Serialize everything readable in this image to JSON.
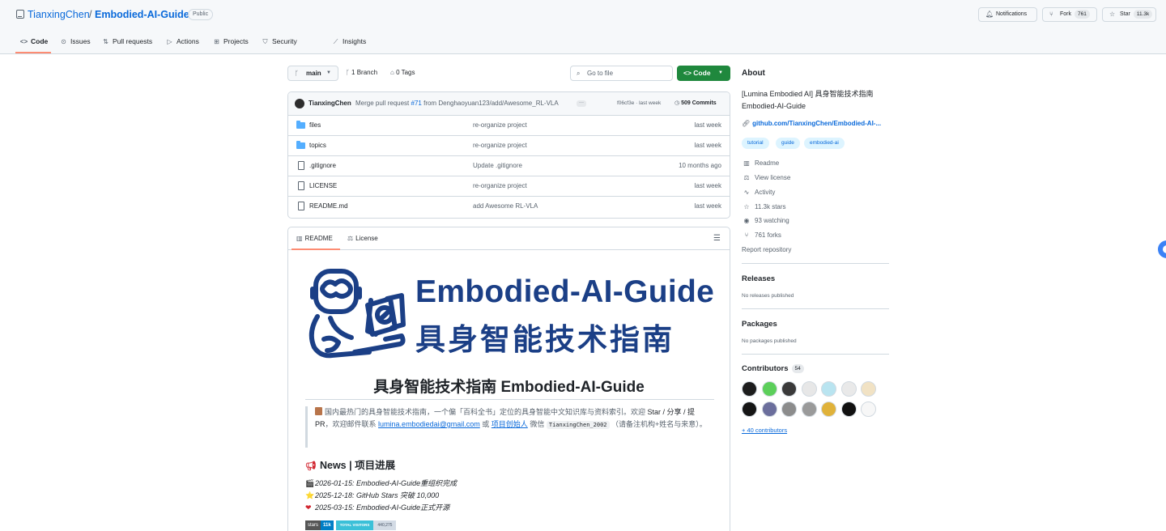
{
  "repo": {
    "owner": "TianxingChen",
    "slash": "/",
    "name": "Embodied-AI-Guide",
    "visibility": "Public"
  },
  "header_buttons": {
    "notifications": "Notifications",
    "fork": "Fork",
    "fork_count": "761",
    "star": "Star",
    "star_count": "11.3k"
  },
  "tabs": [
    {
      "label": "Code",
      "icon": "code-icon"
    },
    {
      "label": "Issues",
      "icon": "issue-icon"
    },
    {
      "label": "Pull requests",
      "icon": "pull-request-icon"
    },
    {
      "label": "Actions",
      "icon": "play-icon"
    },
    {
      "label": "Projects",
      "icon": "table-icon"
    },
    {
      "label": "Security",
      "icon": "shield-icon"
    },
    {
      "label": "Insights",
      "icon": "graph-icon"
    }
  ],
  "toolbar": {
    "branch": "main",
    "branch_count": "1 Branch",
    "tag_count": "0 Tags",
    "goto_placeholder": "Go to file",
    "code_button": "Code"
  },
  "commit": {
    "author": "TianxingChen",
    "msg_prefix": "Merge pull request",
    "pr": "#71",
    "msg_suffix": "from Denghaoyuan123/add/Awesome_RL-VLA",
    "hash_date": "f06cf3e · last week",
    "count": "509 Commits"
  },
  "files": [
    {
      "name": "files",
      "type": "folder",
      "message": "re-organize project",
      "date": "last week"
    },
    {
      "name": "topics",
      "type": "folder",
      "message": "re-organize project",
      "date": "last week"
    },
    {
      "name": ".gitignore",
      "type": "file",
      "message": "Update .gitignore",
      "date": "10 months ago"
    },
    {
      "name": "LICENSE",
      "type": "file",
      "message": "re-organize project",
      "date": "last week"
    },
    {
      "name": "README.md",
      "type": "file",
      "message": "add Awesome RL-VLA",
      "date": "last week"
    }
  ],
  "readme": {
    "tab_readme": "README",
    "tab_license": "License",
    "logo_en": "Embodied-AI-Guide",
    "logo_zh": "具身智能技术指南",
    "h1": "具身智能技术指南 Embodied-AI-Guide",
    "quote": {
      "t1": "国内最热门的具身智能技术指南，一个偏「百科全书」定位的具身智能中文知识库与资料索引。欢迎",
      "s1": "Star / 分享 / 提 PR",
      "t2": "，欢迎邮件联系",
      "email": "lumina.embodiedai@gmail.com",
      "t3": "或",
      "founder": "项目创始人",
      "t4": "微信",
      "wechat": "TianxingChen_2002",
      "t5": "（请备注机构+姓名与来意）。"
    },
    "news_title": "News | 项目进展",
    "news": [
      {
        "emoji": "🎬",
        "text": "2026-01-15: Embodied-AI-Guide重组织完成"
      },
      {
        "emoji": "⭐",
        "text": "2025-12-18: GitHub Stars 突破 10,000"
      },
      {
        "emoji": "❤",
        "text": "2025-03-15: Embodied-AI-Guide正式开源"
      }
    ],
    "badges": {
      "stars_label": "stars",
      "stars_value": "11k",
      "visitors_label": "TOTAL VISITORS",
      "visitors_value": "440,275"
    }
  },
  "about": {
    "title": "About",
    "description": "[Lumina Embodied AI] 具身智能技术指南 Embodied-AI-Guide",
    "link": "github.com/TianxingChen/Embodied-AI-...",
    "topics": [
      "tutorial",
      "guide",
      "embodied-ai"
    ],
    "meta": [
      {
        "icon": "book-icon",
        "label": "Readme"
      },
      {
        "icon": "law-icon",
        "label": "View license"
      },
      {
        "icon": "pulse-icon",
        "label": "Activity"
      },
      {
        "icon": "star-icon",
        "label": "11.3k stars"
      },
      {
        "icon": "eye-icon",
        "label": "93 watching"
      },
      {
        "icon": "fork-icon",
        "label": "761 forks"
      }
    ],
    "report": "Report repository"
  },
  "releases": {
    "title": "Releases",
    "note": "No releases published"
  },
  "packages": {
    "title": "Packages",
    "note": "No packages published"
  },
  "contributors": {
    "title": "Contributors",
    "count": "54",
    "more": "+ 40 contributors",
    "avatar_colors": [
      "#1d1d1d",
      "#5ccf5a",
      "#3a3a3a",
      "#e7e7e7",
      "#b9e4f0",
      "#e9e9e9",
      "#f1e2c4",
      "#151515",
      "#6b6e9c",
      "#8c8c8c",
      "#9a9a9a",
      "#e0b23a",
      "#111111",
      "#f7f7f7"
    ]
  },
  "colors": {
    "accent": "#0969da",
    "green": "#1f883d",
    "logo_blue": "#1b3f86",
    "tab_underline": "#fd8c73"
  }
}
